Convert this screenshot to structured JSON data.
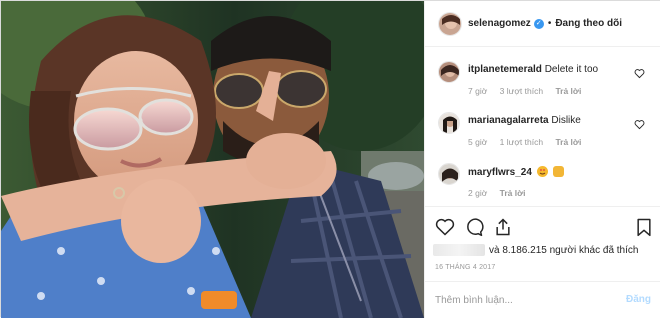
{
  "header": {
    "username": "selenagomez",
    "verified_icon": "verified-badge-icon",
    "separator": "•",
    "follow_status": "Đang theo dõi"
  },
  "comments": [
    {
      "username": "itplanetemerald",
      "text": "Delete it too",
      "time": "7 giờ",
      "likes": "3 lượt thích",
      "reply": "Trả lời"
    },
    {
      "username": "marianagalarreta",
      "text": "Dislike",
      "time": "5 giờ",
      "likes": "1 lượt thích",
      "reply": "Trả lời"
    },
    {
      "username": "maryflwrs_24",
      "text": "",
      "emojis": [
        "heart-eyes-emoji",
        "clapping-hands-emoji"
      ],
      "time": "2 giờ",
      "reply": "Trả lời"
    }
  ],
  "actions": {
    "like_icon": "heart-outline-icon",
    "comment_icon": "comment-bubble-icon",
    "share_icon": "share-icon",
    "save_icon": "bookmark-icon"
  },
  "likes_text": "và 8.186.215 người khác đã thích",
  "date": "16 THÁNG 4 2017",
  "comment_input": {
    "placeholder": "Thêm bình luận...",
    "post_label": "Đăng"
  },
  "colors": {
    "accent": "#3897f0",
    "post_disabled": "#b3dbff",
    "muted": "#999999",
    "text": "#262626"
  }
}
